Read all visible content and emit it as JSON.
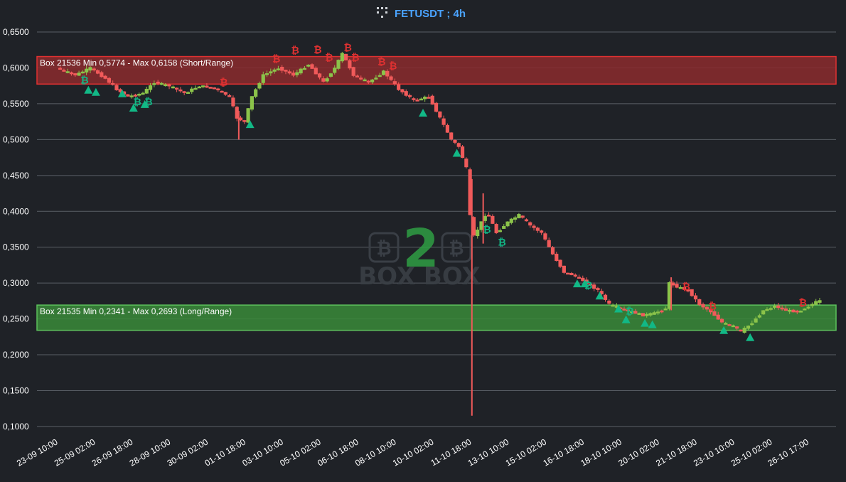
{
  "header": {
    "title": "FETUSDT ; 4h",
    "logo_icon": "boxbox-logo-icon"
  },
  "watermark": {
    "number": "2",
    "text": "BOX BOX",
    "logo_icon": "bitcoin-coin-icon"
  },
  "colors": {
    "background": "#1f2227",
    "grid": "#5a5f66",
    "bull": "#8bc34a",
    "bear": "#f05a5a",
    "short_box": "#8b2a2e",
    "long_box": "#3a8a3a",
    "buy_signal": "#12b886",
    "sell_signal": "#e03131",
    "title": "#4aa3ff"
  },
  "chart_data": {
    "type": "candlestick",
    "title": "FETUSDT ; 4h",
    "ylim": [
      0.09,
      0.655
    ],
    "y_ticks": [
      "0,1000",
      "0,1500",
      "0,2000",
      "0,2500",
      "0,3000",
      "0,3500",
      "0,4000",
      "0,4500",
      "0,5000",
      "0,5500",
      "0,6000",
      "0,6500"
    ],
    "y_tick_values": [
      0.1,
      0.15,
      0.2,
      0.25,
      0.3,
      0.35,
      0.4,
      0.45,
      0.5,
      0.55,
      0.6,
      0.65
    ],
    "x_range_days": [
      "23-09 10:00",
      "27-10 04:00"
    ],
    "x_ticks": [
      "23-09 10:00",
      "25-09 02:00",
      "26-09 18:00",
      "28-09 10:00",
      "30-09 02:00",
      "01-10 18:00",
      "03-10 10:00",
      "05-10 02:00",
      "06-10 18:00",
      "08-10 10:00",
      "10-10 02:00",
      "11-10 18:00",
      "13-10 10:00",
      "15-10 02:00",
      "16-10 18:00",
      "18-10 10:00",
      "20-10 02:00",
      "21-10 18:00",
      "23-10 10:00",
      "25-10 02:00",
      "26-10 17:00"
    ],
    "grid": true,
    "boxes": [
      {
        "label": "Box 21536 Min 0,5774 - Max 0,6158  (Short/Range)",
        "min": 0.5774,
        "max": 0.6158,
        "kind": "short"
      },
      {
        "label": "Box 21535 Min 0,2341 - Max 0,2693  (Long/Range)",
        "min": 0.2341,
        "max": 0.2693,
        "kind": "long"
      }
    ],
    "price_path": [
      [
        "23-09 10:00",
        0.6
      ],
      [
        "24-09 06:00",
        0.59
      ],
      [
        "24-09 22:00",
        0.6
      ],
      [
        "25-09 14:00",
        0.585
      ],
      [
        "26-09 02:00",
        0.57
      ],
      [
        "26-09 14:00",
        0.56
      ],
      [
        "27-09 06:00",
        0.565
      ],
      [
        "27-09 18:00",
        0.58
      ],
      [
        "28-09 10:00",
        0.575
      ],
      [
        "29-09 02:00",
        0.565
      ],
      [
        "29-09 18:00",
        0.575
      ],
      [
        "30-09 10:00",
        0.572
      ],
      [
        "01-10 02:00",
        0.56
      ],
      [
        "01-10 10:00",
        0.53
      ],
      [
        "01-10 18:00",
        0.525
      ],
      [
        "02-10 02:00",
        0.56
      ],
      [
        "02-10 14:00",
        0.59
      ],
      [
        "03-10 06:00",
        0.6
      ],
      [
        "03-10 22:00",
        0.59
      ],
      [
        "04-10 14:00",
        0.605
      ],
      [
        "05-10 06:00",
        0.58
      ],
      [
        "05-10 18:00",
        0.6
      ],
      [
        "06-10 02:00",
        0.62
      ],
      [
        "06-10 14:00",
        0.59
      ],
      [
        "07-10 06:00",
        0.58
      ],
      [
        "07-10 22:00",
        0.595
      ],
      [
        "08-10 14:00",
        0.57
      ],
      [
        "09-10 06:00",
        0.555
      ],
      [
        "09-10 22:00",
        0.56
      ],
      [
        "10-10 10:00",
        0.53
      ],
      [
        "10-10 22:00",
        0.5
      ],
      [
        "11-10 06:00",
        0.49
      ],
      [
        "11-10 14:00",
        0.46
      ],
      [
        "11-10 20:00",
        0.36
      ],
      [
        "12-10 04:00",
        0.38
      ],
      [
        "12-10 12:00",
        0.4
      ],
      [
        "12-10 22:00",
        0.37
      ],
      [
        "13-10 10:00",
        0.385
      ],
      [
        "13-10 22:00",
        0.395
      ],
      [
        "14-10 10:00",
        0.38
      ],
      [
        "14-10 22:00",
        0.37
      ],
      [
        "15-10 10:00",
        0.34
      ],
      [
        "15-10 22:00",
        0.315
      ],
      [
        "16-10 10:00",
        0.31
      ],
      [
        "16-10 22:00",
        0.3
      ],
      [
        "17-10 10:00",
        0.29
      ],
      [
        "17-10 22:00",
        0.27
      ],
      [
        "18-10 10:00",
        0.265
      ],
      [
        "18-10 22:00",
        0.26
      ],
      [
        "19-10 10:00",
        0.255
      ],
      [
        "19-10 22:00",
        0.258
      ],
      [
        "20-10 10:00",
        0.265
      ],
      [
        "20-10 14:00",
        0.3
      ],
      [
        "20-10 22:00",
        0.295
      ],
      [
        "21-10 10:00",
        0.29
      ],
      [
        "21-10 22:00",
        0.27
      ],
      [
        "22-10 10:00",
        0.26
      ],
      [
        "22-10 22:00",
        0.245
      ],
      [
        "23-10 10:00",
        0.24
      ],
      [
        "23-10 18:00",
        0.232
      ],
      [
        "24-10 06:00",
        0.245
      ],
      [
        "24-10 18:00",
        0.262
      ],
      [
        "25-10 06:00",
        0.268
      ],
      [
        "25-10 18:00",
        0.262
      ],
      [
        "26-10 06:00",
        0.26
      ],
      [
        "26-10 18:00",
        0.268
      ],
      [
        "27-10 04:00",
        0.275
      ]
    ],
    "spikes": [
      {
        "time": "01-10 10:00",
        "low": 0.5,
        "high": 0.54
      },
      {
        "time": "11-10 18:00",
        "low": 0.115,
        "high": 0.445
      },
      {
        "time": "12-10 06:00",
        "low": 0.355,
        "high": 0.425
      },
      {
        "time": "20-10 14:00",
        "low": 0.262,
        "high": 0.308
      }
    ],
    "buy_signals": [
      [
        "24-09 18:00",
        0.57
      ],
      [
        "25-09 02:00",
        0.567
      ],
      [
        "26-09 06:00",
        0.565
      ],
      [
        "26-09 18:00",
        0.545
      ],
      [
        "27-09 06:00",
        0.55
      ],
      [
        "01-10 22:00",
        0.522
      ],
      [
        "09-10 14:00",
        0.538
      ],
      [
        "11-10 02:00",
        0.482
      ],
      [
        "16-10 10:00",
        0.3
      ],
      [
        "16-10 18:00",
        0.3
      ],
      [
        "17-10 10:00",
        0.283
      ],
      [
        "18-10 06:00",
        0.265
      ],
      [
        "18-10 14:00",
        0.25
      ],
      [
        "19-10 10:00",
        0.245
      ],
      [
        "19-10 18:00",
        0.243
      ],
      [
        "22-10 22:00",
        0.235
      ],
      [
        "24-10 02:00",
        0.225
      ]
    ],
    "buy_b_labels": [
      [
        "24-09 14:00",
        0.578
      ],
      [
        "26-09 22:00",
        0.548
      ],
      [
        "27-09 10:00",
        0.548
      ],
      [
        "12-10 10:00",
        0.37
      ],
      [
        "13-10 02:00",
        0.352
      ],
      [
        "16-10 22:00",
        0.292
      ],
      [
        "18-10 18:00",
        0.256
      ]
    ],
    "sell_signals": [
      [
        "03-10 02:00",
        0.608
      ],
      [
        "03-10 22:00",
        0.62
      ],
      [
        "04-10 22:00",
        0.621
      ],
      [
        "05-10 10:00",
        0.61
      ],
      [
        "06-10 06:00",
        0.624
      ],
      [
        "06-10 14:00",
        0.61
      ],
      [
        "07-10 18:00",
        0.604
      ],
      [
        "08-10 06:00",
        0.598
      ],
      [
        "30-09 18:00",
        0.575
      ],
      [
        "21-10 06:00",
        0.29
      ],
      [
        "22-10 10:00",
        0.263
      ],
      [
        "26-10 10:00",
        0.268
      ]
    ]
  }
}
